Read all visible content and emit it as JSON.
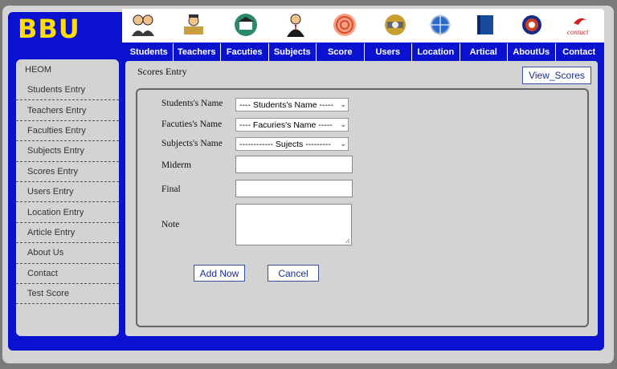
{
  "logo": "BBU",
  "topbar": {
    "icons": [
      "students-icon",
      "teachers-icon",
      "faculties-icon",
      "subjects-icon",
      "score-icon",
      "users-icon",
      "location-icon",
      "article-icon",
      "about-us-icon",
      "contact-icon"
    ],
    "contact_logo_text": "contact"
  },
  "nav": [
    "Students",
    "Teachers",
    "Facuties",
    "Subjects",
    "Score",
    "Users",
    "Location",
    "Artical",
    "AboutUs",
    "Contact"
  ],
  "sidebar": {
    "header": "HEOM",
    "items": [
      "Students Entry",
      "Teachers Entry",
      "Faculties Entry",
      "Subjects Entry",
      "Scores Entry",
      "Users Entry",
      "Location Entry",
      "Article Entry",
      "About Us",
      "Contact",
      "Test Score"
    ]
  },
  "main": {
    "title": "Scores Entry",
    "view_button": "View_Scores",
    "form": {
      "student_label": "Students's Name",
      "student_value": "---- Students's Name -----",
      "faculty_label": "Facuties's Name",
      "faculty_value": "---- Facuries's Name -----",
      "subject_label": "Subjects's Name",
      "subject_value": "------------ Sujects ---------",
      "midterm_label": "Miderm",
      "final_label": "Final",
      "note_label": "Note",
      "add_button": "Add Now",
      "cancel_button": "Cancel"
    }
  },
  "colors": {
    "brand_blue": "#0a12d0",
    "logo_yellow": "#ffde00",
    "panel_gray": "#d3d3d3"
  }
}
